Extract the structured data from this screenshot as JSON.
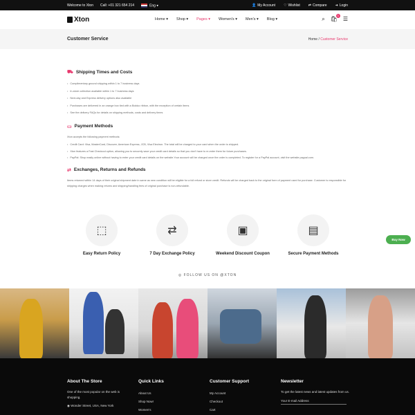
{
  "topbar": {
    "welcome": "Welcome to Xton",
    "phone": "Call: +01 321 654 214",
    "language": "Eng",
    "account": "My Account",
    "wishlist": "Wishlist",
    "compare": "Compare",
    "login": "Login"
  },
  "header": {
    "logo": "Xton",
    "nav": [
      "Home",
      "Shop",
      "Pages",
      "Women's",
      "Men's",
      "Blog"
    ],
    "active_nav": "Pages",
    "cart_count": "1"
  },
  "pagehead": {
    "title": "Customer Service",
    "crumb_home": "Home",
    "crumb_current": "Customer Service"
  },
  "sections": {
    "shipping": {
      "title": "Shipping Times and Costs",
      "items": [
        "Complimentary ground shipping within 1 to 7 business days",
        "In-store collection available within 1 to 7 business days",
        "Next-day and Express delivery options also available",
        "Purchases are delivered in an orange box tied with a Bolduc ribbon, with the exception of certain items",
        "See the delivery FAQs for details on shipping methods, costs and delivery times"
      ]
    },
    "payment": {
      "title": "Payment Methods",
      "intro": "Xton accepts the following payment methods:",
      "items": [
        "Credit Card: Visa, MasterCard, Discover, American Express, JCB, Visa Electron. The total will be charged to your card when the order is shipped.",
        "Xton features a Fast Checkout option, allowing you to securely save your credit card details so that you don't have to re-enter them for future purchases.",
        "PayPal: Shop easily online without having to enter your credit card details on the website.Your account will be charged once the order is completed. To register for a PayPal account, visit the website paypal.com."
      ]
    },
    "exchanges": {
      "title": "Exchanges, Returns and Refunds",
      "text": "Items returned within 14 days of their original shipment date in same as new condition will be eligible for a full refund or store credit. Refunds will be charged back to the original form of payment used for purchase. Customer is responsible for shipping charges when making returns and shipping/handling fees of original purchase is non-refundable."
    }
  },
  "features": [
    {
      "label": "Easy Return Policy",
      "icon": "box-return-icon"
    },
    {
      "label": "7 Day Exchange Policy",
      "icon": "exchange-icon"
    },
    {
      "label": "Weekend Discount Coupon",
      "icon": "coupon-icon"
    },
    {
      "label": "Secure Payment Methods",
      "icon": "card-icon"
    }
  ],
  "buy_now": "Buy Now",
  "follow": "FOLLOW US ON @XTON",
  "footer": {
    "about_title": "About The Store",
    "about_text": "One of the most popular on the web is shopping.",
    "about_address": "Wonder Street, USA, New York",
    "links_title": "Quick Links",
    "links": [
      "About Us",
      "Shop Now!",
      "Women's"
    ],
    "support_title": "Customer Support",
    "support": [
      "My Account",
      "Checkout",
      "Cart"
    ],
    "newsletter_title": "Newsletter",
    "newsletter_text": "To get the latest news and latest updates from us.",
    "newsletter_placeholder": "Your E-mail Address"
  }
}
